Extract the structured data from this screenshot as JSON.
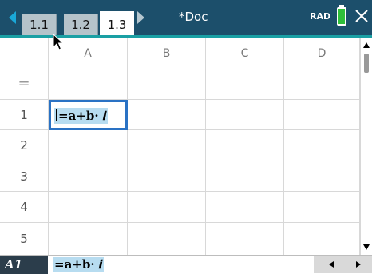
{
  "topbar": {
    "tabs": [
      {
        "label": "1.1",
        "active": false
      },
      {
        "label": "1.2",
        "active": false
      },
      {
        "label": "1.3",
        "active": true
      }
    ],
    "doc_title": "*Doc",
    "angle_mode": "RAD",
    "icons": {
      "prev": "left-triangle-icon",
      "next": "right-triangle-icon",
      "battery": "battery-icon",
      "close": "close-icon"
    },
    "colors": {
      "bar": "#1c4f6b",
      "accent": "#1aa0a4",
      "battery": "#2fbf3a"
    }
  },
  "sheet": {
    "columns": [
      "A",
      "B",
      "C",
      "D"
    ],
    "formula_row_symbol": "=",
    "rows": [
      "1",
      "2",
      "3",
      "4",
      "5"
    ],
    "selected_cell": {
      "ref": "A1",
      "content": "=a+b· 𝒊"
    }
  },
  "entry_line": {
    "cell_ref": "A1",
    "content": "=a+b· 𝒊"
  },
  "scrollbar": {
    "icons": {
      "up": "up-arrow-icon",
      "down": "down-arrow-icon"
    }
  }
}
